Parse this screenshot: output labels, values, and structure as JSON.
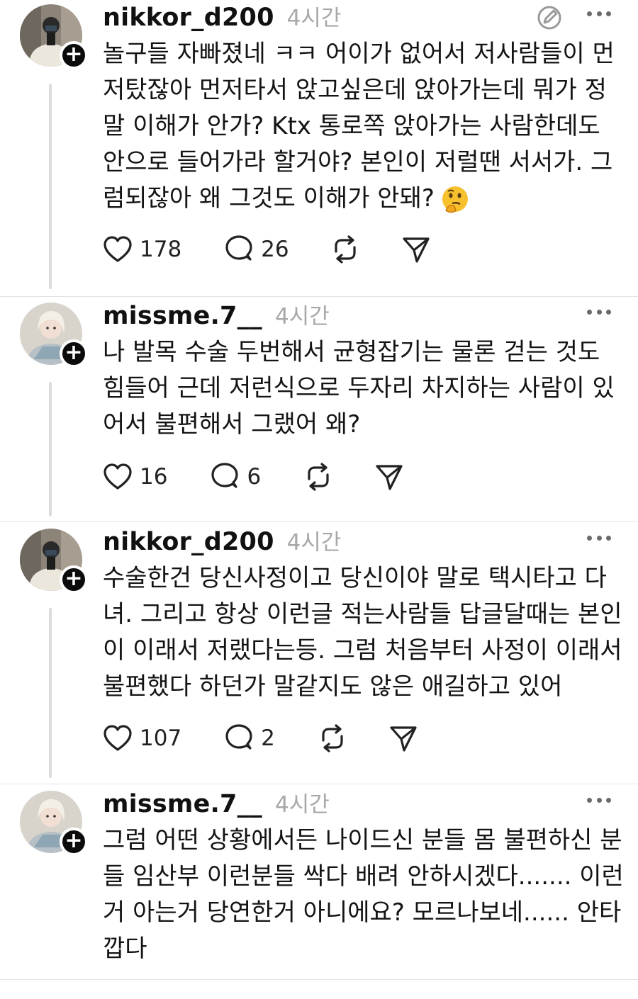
{
  "posts": [
    {
      "username": "nikkor_d200",
      "time": "4시간",
      "lines": [
        "놀구들 자빠졌네 ㅋㅋ 어이가 없어서 저사람들이 먼",
        "저탔잖아 먼저타서 앉고싶은데 앉아가는데 뭐가 정",
        "말 이해가 안가? Ktx 통로쪽 앉아가는 사람한데도",
        "안으로 들어가라 할거야? 본인이 저럴땐 서서가. 그",
        "럼되잖아 왜 그것도 이해가 안돼?"
      ],
      "emoji": "thinking-face",
      "likes": "178",
      "comments": "26"
    },
    {
      "username": "missme.7__",
      "time": "4시간",
      "lines": [
        "나 발목 수술 두번해서 균형잡기는 물론 걷는 것도",
        "힘들어 근데 저런식으로 두자리 차지하는 사람이 있",
        "어서 불편해서 그랬어 왜?"
      ],
      "likes": "16",
      "comments": "6"
    },
    {
      "username": "nikkor_d200",
      "time": "4시간",
      "lines": [
        "수술한건 당신사정이고 당신이야 말로 택시타고 다",
        "녀. 그리고 항상 이런글 적는사람들 답글달때는 본인",
        "이 이래서 저랬다는등. 그럼 처음부터 사정이 이래서",
        "불편했다 하던가 말같지도 않은 애길하고 있어"
      ],
      "likes": "107",
      "comments": "2"
    },
    {
      "username": "missme.7__",
      "time": "4시간",
      "lines": [
        "그럼 어떤 상황에서든 나이드신 분들 몸 불편하신 분",
        "들 임산부 이런분들 싹다 배려 안하시겠다....... 이런",
        "거 아는거 당연한거 아니에요? 모르나보네...... 안타",
        "깝다"
      ]
    }
  ],
  "icons": {
    "like": "heart-icon",
    "comment": "comment-bubble-icon",
    "repost": "repost-icon",
    "share": "send-icon",
    "follow": "plus-icon",
    "more": "more-dots-icon",
    "edit": "edit-pencil-icon"
  },
  "colors": {
    "text": "#141414",
    "muted": "#a8a8a8",
    "thread_line": "#dcdcdc",
    "follow_badge": "#0b0b0b"
  }
}
